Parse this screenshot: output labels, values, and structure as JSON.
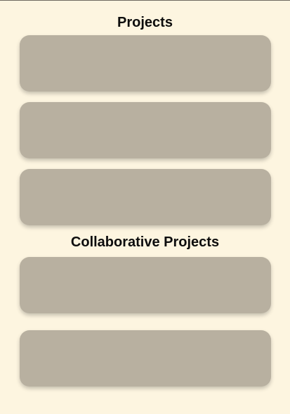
{
  "projects": {
    "title": "Projects",
    "cards": [
      {
        "name": ""
      },
      {
        "name": ""
      },
      {
        "name": ""
      }
    ]
  },
  "collaborative": {
    "title": "Collaborative Projects",
    "cards": [
      {
        "name": ""
      },
      {
        "name": ""
      }
    ]
  },
  "colors": {
    "background": "#fdf5e0",
    "card": "#b8b0a0",
    "title_text": "#0d0d0d"
  }
}
